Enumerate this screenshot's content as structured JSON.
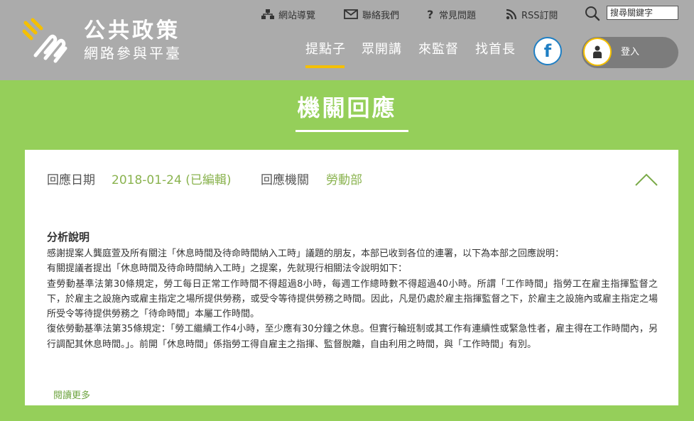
{
  "header": {
    "logo_title": "公共政策",
    "logo_subtitle": "網路參與平臺",
    "utility_links": [
      "網站導覽",
      "聯絡我們",
      "常見問題",
      "RSS訂閱"
    ],
    "search_placeholder": "搜尋關鍵字",
    "nav_items": [
      "提點子",
      "眾開講",
      "來監督",
      "找首長"
    ],
    "facebook_glyph": "f",
    "login_label": "登入"
  },
  "page": {
    "title": "機關回應"
  },
  "response": {
    "date_label": "回應日期",
    "date_value": "2018-01-24 (已編輯)",
    "agency_label": "回應機關",
    "agency_value": "勞動部",
    "section_title": "分析說明",
    "paragraphs": [
      "感謝提案人龔庭萱及所有關注「休息時間及待命時間納入工時」議題的朋友，本部已收到各位的連署，以下為本部之回應說明：",
      "有關提議者提出「休息時間及待命時間納入工時」之提案，先就現行相關法令說明如下：",
      "查勞動基準法第30條規定，勞工每日正常工作時間不得超過8小時，每週工作總時數不得超過40小時。所謂「工作時間」指勞工在雇主指揮監督之下，於雇主之設施內或雇主指定之場所提供勞務，或受令等待提供勞務之時間。因此，凡是仍處於雇主指揮監督之下，於雇主之設施內或雇主指定之場所受令等待提供勞務之「待命時間」本屬工作時間。",
      "復依勞動基準法第35條規定：「勞工繼續工作4小時，至少應有30分鐘之休息。但實行輪班制或其工作有連續性或緊急性者，雇主得在工作時間內，另行調配其休息時間。」。前開「休息時間」係指勞工得自雇主之指揮、監督脫離，自由利用之時間，與「工作時間」有別。"
    ],
    "read_more": "閱讀更多"
  },
  "colors": {
    "header_bg": "#ababab",
    "page_bg": "#95cf5a",
    "accent_yellow": "#f5c000",
    "value_green": "#8ab34f",
    "facebook_blue": "#1f7fc4"
  },
  "icons": [
    "sitemap-icon",
    "mail-icon",
    "question-icon",
    "rss-icon",
    "search-icon",
    "facebook-icon",
    "user-icon",
    "chevron-up-icon"
  ]
}
